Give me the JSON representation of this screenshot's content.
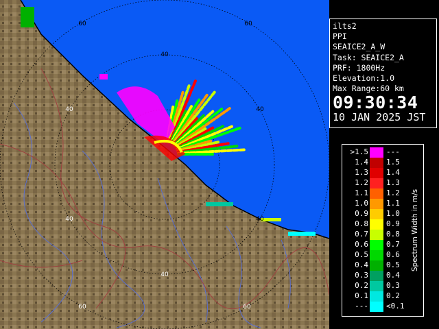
{
  "info": {
    "site": "ilts2",
    "product": "PPI",
    "scan": "SEAICE2_A_W",
    "task": "Task: SEAICE2_A",
    "prf": "PRF: 1800Hz",
    "elevation": "Elevation:1.0",
    "max_range": "Max Range:60 km",
    "time": "09:30:34",
    "date": "10 JAN 2025 JST"
  },
  "legend": {
    "unit_label": "Spectrum Width in m/s",
    "rows": [
      {
        "lo": ">1.5",
        "hi": "---",
        "color": "#ff00ff"
      },
      {
        "lo": "1.4",
        "hi": "1.5",
        "color": "#c00000"
      },
      {
        "lo": "1.3",
        "hi": "1.4",
        "color": "#e00000"
      },
      {
        "lo": "1.2",
        "hi": "1.3",
        "color": "#ff2020"
      },
      {
        "lo": "1.1",
        "hi": "1.2",
        "color": "#ff6000"
      },
      {
        "lo": "1.0",
        "hi": "1.1",
        "color": "#ff9900"
      },
      {
        "lo": "0.9",
        "hi": "1.0",
        "color": "#ffcc00"
      },
      {
        "lo": "0.8",
        "hi": "0.9",
        "color": "#ffff00"
      },
      {
        "lo": "0.7",
        "hi": "0.8",
        "color": "#c8ff00"
      },
      {
        "lo": "0.6",
        "hi": "0.7",
        "color": "#00ff00"
      },
      {
        "lo": "0.5",
        "hi": "0.6",
        "color": "#00d800"
      },
      {
        "lo": "0.4",
        "hi": "0.5",
        "color": "#00b000"
      },
      {
        "lo": "0.3",
        "hi": "0.4",
        "color": "#00a060"
      },
      {
        "lo": "0.2",
        "hi": "0.3",
        "color": "#00c8a0"
      },
      {
        "lo": "0.1",
        "hi": "0.2",
        "color": "#00e8e0"
      },
      {
        "lo": "---",
        "hi": "<0.1",
        "color": "#00ffff"
      }
    ]
  },
  "map": {
    "range_ring_labels": [
      "60",
      "40",
      "40",
      "60",
      "40",
      "40",
      "40",
      "60",
      "40",
      "60"
    ],
    "sea_color": "#0a5af5",
    "land_color": "#8a7650"
  }
}
